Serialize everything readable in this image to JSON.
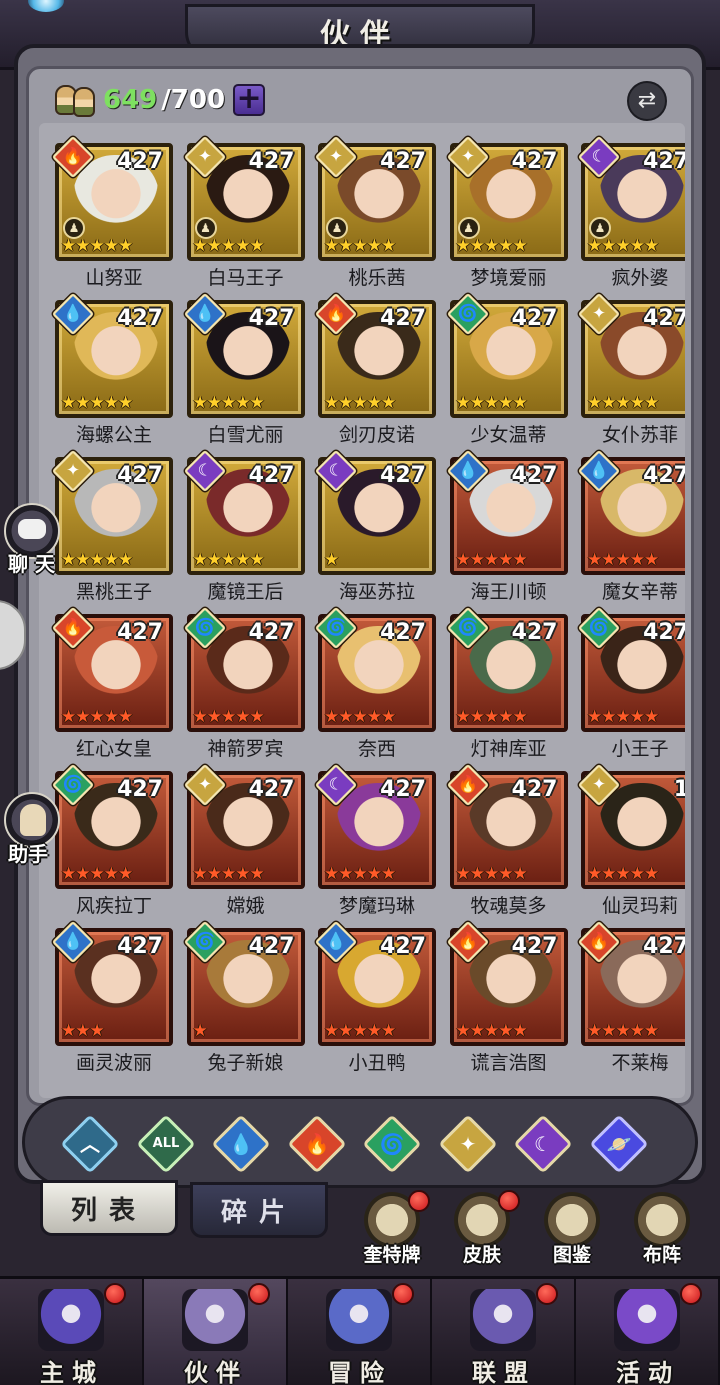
{
  "title": "伙伴",
  "hero_count": {
    "current": "649",
    "max": "/700"
  },
  "heroes": [
    {
      "name": "山努亚",
      "level": "427",
      "element": "fire",
      "glyph": "🔥",
      "stars": 5,
      "star_color": "gold",
      "frame": "gold",
      "hair": "#e8e8e0",
      "class_badge": true
    },
    {
      "name": "白马王子",
      "level": "427",
      "element": "light",
      "glyph": "✦",
      "stars": 5,
      "star_color": "gold",
      "frame": "gold",
      "hair": "#2a1a12",
      "class_badge": true
    },
    {
      "name": "桃乐茜",
      "level": "427",
      "element": "light",
      "glyph": "✦",
      "stars": 5,
      "star_color": "gold",
      "frame": "gold",
      "hair": "#7a4a2a",
      "class_badge": true
    },
    {
      "name": "梦境爱丽",
      "level": "427",
      "element": "light",
      "glyph": "✦",
      "stars": 5,
      "star_color": "gold",
      "frame": "gold",
      "hair": "#a8702a",
      "class_badge": true
    },
    {
      "name": "疯外婆",
      "level": "427",
      "element": "dark",
      "glyph": "☾",
      "stars": 5,
      "star_color": "gold",
      "frame": "gold",
      "hair": "#4a3a5a",
      "class_badge": true
    },
    {
      "name": "海螺公主",
      "level": "427",
      "element": "water",
      "glyph": "💧",
      "stars": 5,
      "star_color": "gold",
      "frame": "gold",
      "hair": "#e0b858",
      "class_badge": false
    },
    {
      "name": "白雪尤丽",
      "level": "427",
      "element": "water",
      "glyph": "💧",
      "stars": 5,
      "star_color": "gold",
      "frame": "gold",
      "hair": "#1a1418",
      "class_badge": false
    },
    {
      "name": "剑刃皮诺",
      "level": "427",
      "element": "fire",
      "glyph": "🔥",
      "stars": 5,
      "star_color": "gold",
      "frame": "gold",
      "hair": "#3a2a1a",
      "class_badge": false
    },
    {
      "name": "少女温蒂",
      "level": "427",
      "element": "wind",
      "glyph": "🌀",
      "stars": 5,
      "star_color": "gold",
      "frame": "gold",
      "hair": "#d8a848",
      "class_badge": false
    },
    {
      "name": "女仆苏菲",
      "level": "427",
      "element": "light",
      "glyph": "✦",
      "stars": 5,
      "star_color": "gold",
      "frame": "gold",
      "hair": "#8a4a2a",
      "class_badge": false
    },
    {
      "name": "黑桃王子",
      "level": "427",
      "element": "light",
      "glyph": "✦",
      "stars": 5,
      "star_color": "gold",
      "frame": "gold",
      "hair": "#b8b8b8",
      "class_badge": false
    },
    {
      "name": "魔镜王后",
      "level": "427",
      "element": "dark",
      "glyph": "☾",
      "stars": 5,
      "star_color": "gold",
      "frame": "gold",
      "hair": "#7a2a2a",
      "class_badge": false
    },
    {
      "name": "海巫苏拉",
      "level": "427",
      "element": "dark",
      "glyph": "☾",
      "stars": 1,
      "star_color": "gold",
      "frame": "gold",
      "hair": "#2a1a2a",
      "class_badge": false
    },
    {
      "name": "海王川顿",
      "level": "427",
      "element": "water",
      "glyph": "💧",
      "stars": 5,
      "star_color": "red",
      "frame": "red",
      "hair": "#d8d8d8",
      "class_badge": false
    },
    {
      "name": "魔女辛蒂",
      "level": "427",
      "element": "water",
      "glyph": "💧",
      "stars": 5,
      "star_color": "red",
      "frame": "red",
      "hair": "#d8b868",
      "class_badge": false
    },
    {
      "name": "红心女皇",
      "level": "427",
      "element": "fire",
      "glyph": "🔥",
      "stars": 5,
      "star_color": "red",
      "frame": "red",
      "hair": "#c85a3a",
      "class_badge": false
    },
    {
      "name": "神箭罗宾",
      "level": "427",
      "element": "wind",
      "glyph": "🌀",
      "stars": 5,
      "star_color": "red",
      "frame": "red",
      "hair": "#5a2a1a",
      "class_badge": false
    },
    {
      "name": "奈西",
      "level": "427",
      "element": "wind",
      "glyph": "🌀",
      "stars": 5,
      "star_color": "red",
      "frame": "red",
      "hair": "#e8c070",
      "class_badge": false
    },
    {
      "name": "灯神库亚",
      "level": "427",
      "element": "wind",
      "glyph": "🌀",
      "stars": 5,
      "star_color": "red",
      "frame": "red",
      "hair": "#4a6a4a",
      "class_badge": false
    },
    {
      "name": "小王子",
      "level": "427",
      "element": "wind",
      "glyph": "🌀",
      "stars": 5,
      "star_color": "red",
      "frame": "red",
      "hair": "#3a2418",
      "class_badge": false
    },
    {
      "name": "风疾拉丁",
      "level": "427",
      "element": "wind",
      "glyph": "🌀",
      "stars": 5,
      "star_color": "red",
      "frame": "red",
      "hair": "#3a2a1a",
      "class_badge": false
    },
    {
      "name": "嫦娥",
      "level": "427",
      "element": "light",
      "glyph": "✦",
      "stars": 5,
      "star_color": "red",
      "frame": "red",
      "hair": "#4a2a1a",
      "class_badge": false
    },
    {
      "name": "梦魔玛琳",
      "level": "427",
      "element": "dark",
      "glyph": "☾",
      "stars": 5,
      "star_color": "red",
      "frame": "red",
      "hair": "#8a3a9a",
      "class_badge": false
    },
    {
      "name": "牧魂莫多",
      "level": "427",
      "element": "fire",
      "glyph": "🔥",
      "stars": 5,
      "star_color": "red",
      "frame": "red",
      "hair": "#5a3a28",
      "class_badge": false
    },
    {
      "name": "仙灵玛莉",
      "level": "1",
      "element": "light",
      "glyph": "✦",
      "stars": 5,
      "star_color": "red",
      "frame": "red",
      "hair": "#2a2418",
      "class_badge": false
    },
    {
      "name": "画灵波丽",
      "level": "427",
      "element": "water",
      "glyph": "💧",
      "stars": 3,
      "star_color": "red",
      "frame": "red",
      "hair": "#5a3020",
      "class_badge": false
    },
    {
      "name": "兔子新娘",
      "level": "427",
      "element": "wind",
      "glyph": "🌀",
      "stars": 1,
      "star_color": "red",
      "frame": "red",
      "hair": "#a87a3a",
      "class_badge": false
    },
    {
      "name": "小丑鸭",
      "level": "427",
      "element": "water",
      "glyph": "💧",
      "stars": 5,
      "star_color": "red",
      "frame": "red",
      "hair": "#d8a830",
      "class_badge": false
    },
    {
      "name": "谎言浩图",
      "level": "427",
      "element": "fire",
      "glyph": "🔥",
      "stars": 5,
      "star_color": "red",
      "frame": "red",
      "hair": "#6a4a2a",
      "class_badge": false
    },
    {
      "name": "不莱梅",
      "level": "427",
      "element": "fire",
      "glyph": "🔥",
      "stars": 5,
      "star_color": "red",
      "frame": "red",
      "hair": "#8a6a5a",
      "class_badge": false
    }
  ],
  "filters": [
    {
      "id": "up",
      "glyph": "︿"
    },
    {
      "id": "all",
      "glyph": "ALL"
    },
    {
      "id": "water",
      "glyph": "💧"
    },
    {
      "id": "fire",
      "glyph": "🔥"
    },
    {
      "id": "wind",
      "glyph": "🌀"
    },
    {
      "id": "light",
      "glyph": "✦"
    },
    {
      "id": "dark",
      "glyph": "☾"
    },
    {
      "id": "star",
      "glyph": "🪐"
    }
  ],
  "tabs": {
    "list": "列表",
    "shards": "碎片"
  },
  "shortcuts": [
    {
      "label": "奎特牌",
      "dot": true
    },
    {
      "label": "皮肤",
      "dot": true
    },
    {
      "label": "图鉴",
      "dot": false
    },
    {
      "label": "布阵",
      "dot": false
    }
  ],
  "side": {
    "chat": "聊 天",
    "assistant": "助手"
  },
  "nav": [
    {
      "label": "主城",
      "dot": true,
      "color": "#5a4ab8"
    },
    {
      "label": "伙伴",
      "dot": true,
      "color": "#8a7ab8"
    },
    {
      "label": "冒险",
      "dot": true,
      "color": "#5a6ac8"
    },
    {
      "label": "联盟",
      "dot": true,
      "color": "#6a5ab0"
    },
    {
      "label": "活动",
      "dot": true,
      "color": "#7a4ac8"
    }
  ],
  "colors": {
    "fire": "#d8452a",
    "water": "#2e72c8",
    "wind": "#2aa060",
    "light": "#c7a540",
    "dark": "#7a3cc0"
  }
}
